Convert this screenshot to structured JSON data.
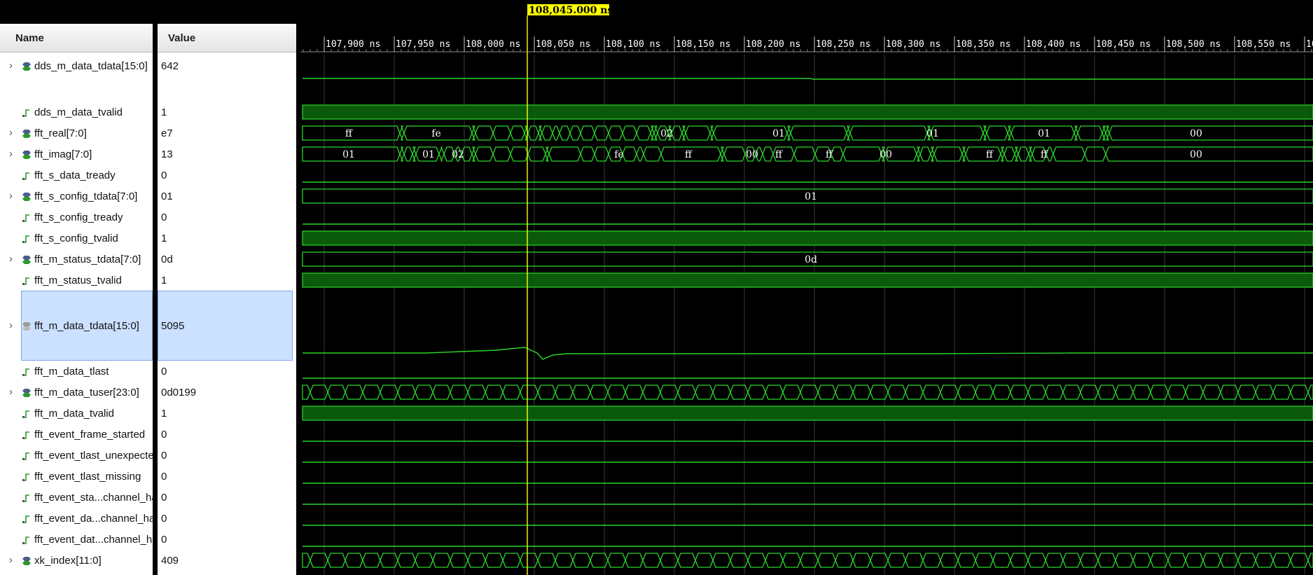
{
  "header": {
    "name_label": "Name",
    "value_label": "Value"
  },
  "cursor_label": "108,045.000 ns",
  "ticks": [
    "107,900 ns",
    "107,950 ns",
    "108,000 ns",
    "108,050 ns",
    "108,100 ns",
    "108,150 ns",
    "108,200 ns",
    "108,250 ns",
    "108,300 ns",
    "108,350 ns",
    "108,400 ns",
    "108,450 ns",
    "108,500 ns",
    "108,550 ns",
    "10"
  ],
  "colors": {
    "wave_green": "#2bd62b",
    "valid_fill": "#0b5a0b",
    "cursor_yellow": "#ffff00",
    "selection": "#cce0ff"
  },
  "signals": [
    {
      "name": "dds_m_data_tdata[15:0]",
      "value": "642",
      "kind": "bus",
      "expandable": true,
      "icon": "bus-icon"
    },
    {
      "name": "dds_m_data_tvalid",
      "value": "1",
      "kind": "bit",
      "expandable": false,
      "icon": "bit-icon"
    },
    {
      "name": "fft_real[7:0]",
      "value": "e7",
      "kind": "bus",
      "expandable": true,
      "icon": "bus-icon"
    },
    {
      "name": "fft_imag[7:0]",
      "value": "13",
      "kind": "bus",
      "expandable": true,
      "icon": "bus-icon"
    },
    {
      "name": "fft_s_data_tready",
      "value": "0",
      "kind": "bit",
      "expandable": false,
      "icon": "bit-icon"
    },
    {
      "name": "fft_s_config_tdata[7:0]",
      "value": "01",
      "kind": "bus",
      "expandable": true,
      "icon": "bus-icon"
    },
    {
      "name": "fft_s_config_tready",
      "value": "0",
      "kind": "bit",
      "expandable": false,
      "icon": "bit-icon"
    },
    {
      "name": "fft_s_config_tvalid",
      "value": "1",
      "kind": "bit",
      "expandable": false,
      "icon": "bit-icon"
    },
    {
      "name": "fft_m_status_tdata[7:0]",
      "value": "0d",
      "kind": "bus",
      "expandable": true,
      "icon": "bus-icon"
    },
    {
      "name": "fft_m_status_tvalid",
      "value": "1",
      "kind": "bit",
      "expandable": false,
      "icon": "bit-icon"
    },
    {
      "name": "fft_m_data_tdata[15:0]",
      "value": "5095",
      "kind": "analog",
      "expandable": true,
      "icon": "analog-bus-icon",
      "selected": true
    },
    {
      "name": "fft_m_data_tlast",
      "value": "0",
      "kind": "bit",
      "expandable": false,
      "icon": "bit-icon"
    },
    {
      "name": "fft_m_data_tuser[23:0]",
      "value": "0d0199",
      "kind": "bus",
      "expandable": true,
      "icon": "bus-icon"
    },
    {
      "name": "fft_m_data_tvalid",
      "value": "1",
      "kind": "bit",
      "expandable": false,
      "icon": "bit-icon"
    },
    {
      "name": "fft_event_frame_started",
      "value": "0",
      "kind": "bit",
      "expandable": false,
      "icon": "bit-icon"
    },
    {
      "name": "fft_event_tlast_unexpected",
      "value": "0",
      "kind": "bit",
      "expandable": false,
      "icon": "bit-icon"
    },
    {
      "name": "fft_event_tlast_missing",
      "value": "0",
      "kind": "bit",
      "expandable": false,
      "icon": "bit-icon"
    },
    {
      "name": "fft_event_sta...channel_halt",
      "value": "0",
      "kind": "bit",
      "expandable": false,
      "icon": "bit-icon"
    },
    {
      "name": "fft_event_da...channel_halt",
      "value": "0",
      "kind": "bit",
      "expandable": false,
      "icon": "bit-icon"
    },
    {
      "name": "fft_event_dat...channel_halt",
      "value": "0",
      "kind": "bit",
      "expandable": false,
      "icon": "bit-icon"
    },
    {
      "name": "xk_index[11:0]",
      "value": "409",
      "kind": "bus",
      "expandable": true,
      "icon": "bus-icon"
    }
  ],
  "bus_labels": {
    "fft_real": [
      "ff",
      "fe",
      "02",
      "01",
      "01",
      "01",
      "00"
    ],
    "fft_imag": [
      "01",
      "01",
      "02",
      "fe",
      "ff",
      "00",
      "ff",
      "ff",
      "00",
      "ff",
      "ff",
      "00"
    ],
    "fft_s_config_tdata": [
      "01"
    ],
    "fft_m_status_tdata": [
      "0d"
    ]
  }
}
